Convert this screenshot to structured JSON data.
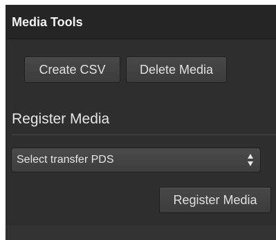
{
  "panel": {
    "title": "Media Tools"
  },
  "toolbar": {
    "create_csv_label": "Create CSV",
    "delete_media_label": "Delete Media"
  },
  "register_section": {
    "title": "Register Media",
    "select": {
      "selected": "Select transfer PDS",
      "arrow_icon": "up-down-arrows-icon"
    },
    "register_button_label": "Register Media"
  },
  "colors": {
    "panel_bg": "#2e2e2e",
    "header_bg": "#252525",
    "button_bg": "#444444",
    "text": "#e6e6e6"
  }
}
